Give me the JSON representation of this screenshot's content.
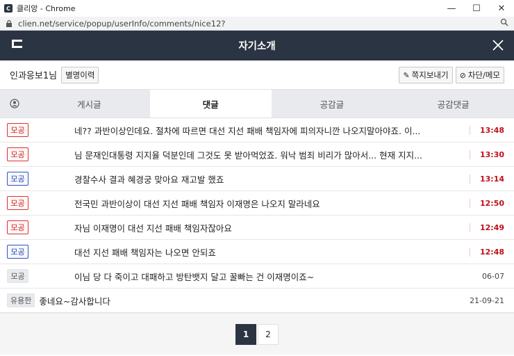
{
  "window": {
    "title": "클리앙 - Chrome",
    "app_icon": "C"
  },
  "address": {
    "url": "clien.net/service/popup/userInfo/comments/nice12?"
  },
  "header": {
    "title": "자기소개"
  },
  "user": {
    "name": "인과응보1님",
    "nick_history_label": "별명이력",
    "send_message_label": "쪽지보내기",
    "block_memo_label": "차단/메모"
  },
  "tabs": [
    {
      "label": "게시글"
    },
    {
      "label": "댓글"
    },
    {
      "label": "공감글"
    },
    {
      "label": "공감댓글"
    }
  ],
  "rows": [
    {
      "badge": "모공",
      "badge_style": "red",
      "text": "네?? 과반이상인데요. 절차에 따르면 대선 지선 패배 책임자에 피의자니깐 나오지말아야죠. 이...",
      "time": "13:48"
    },
    {
      "badge": "모공",
      "badge_style": "red",
      "text": "님 문재인대통령 지지율 덕분인데 그것도 못 받아먹었죠. 워낙 범죄 비리가 많아서... 현재 지지...",
      "time": "13:30"
    },
    {
      "badge": "모공",
      "badge_style": "blue",
      "text": "경찰수사 결과 혜경궁 맞아요 재고발 했죠",
      "time": "13:14"
    },
    {
      "badge": "모공",
      "badge_style": "red",
      "text": "전국민 과반이상이 대선 지선 패배 책임자 이재명은 나오지 말라네요",
      "time": "12:50"
    },
    {
      "badge": "모공",
      "badge_style": "red",
      "text": "자님 이재명이 대선 지선 패배 책임자잖아요",
      "time": "12:49"
    },
    {
      "badge": "모공",
      "badge_style": "blue",
      "text": "대선 지선 패배 책임자는 나오면 안되죠",
      "time": "12:48"
    },
    {
      "badge": "모공",
      "badge_style": "gray",
      "text": "이님 당 다 죽이고 대패하고 방탄뱃지 달고 꿀빠는 건 이재명이죠~",
      "time": "06-07"
    },
    {
      "badge": "유용한",
      "badge_style": "gray",
      "text": "좋네요~감사합니다",
      "time": "21-09-21"
    }
  ],
  "pagination": {
    "pages": [
      "1",
      "2"
    ],
    "current": "1"
  }
}
